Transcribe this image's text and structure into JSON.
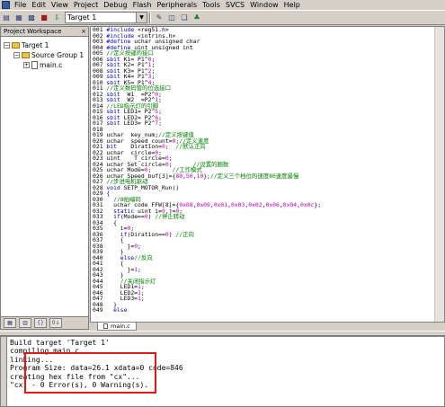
{
  "menu": [
    "File",
    "Edit",
    "View",
    "Project",
    "Debug",
    "Flash",
    "Peripherals",
    "Tools",
    "SVCS",
    "Window",
    "Help"
  ],
  "toolbar": {
    "target": "Target 1"
  },
  "workspace": {
    "title": "Project Workspace",
    "close": "×",
    "tree": [
      {
        "label": "Target 1",
        "level": 0,
        "toggle": "−",
        "kind": "folder"
      },
      {
        "label": "Source Group 1",
        "level": 1,
        "toggle": "−",
        "kind": "folder"
      },
      {
        "label": "main.c",
        "level": 2,
        "toggle": "+",
        "kind": "file"
      }
    ]
  },
  "editor": {
    "tab": "main.c",
    "lines": [
      [
        "001",
        [
          [
            "kw",
            "#include "
          ],
          [
            "t",
            "<reg51.h>"
          ]
        ]
      ],
      [
        "002",
        [
          [
            "kw",
            "#include "
          ],
          [
            "t",
            "<intrins.h>"
          ]
        ]
      ],
      [
        "003",
        [
          [
            "kw",
            "#define "
          ],
          [
            "t",
            "uchar unsigned char"
          ]
        ]
      ],
      [
        "004",
        [
          [
            "kw",
            "#define "
          ],
          [
            "t",
            "uint unsigned int"
          ]
        ]
      ],
      [
        "005",
        [
          [
            "cm",
            "//定义按键的接口"
          ]
        ]
      ],
      [
        "006",
        [
          [
            "kw",
            "sbit "
          ],
          [
            "t",
            "K1= P1^"
          ],
          [
            "num",
            "0"
          ],
          [
            "t",
            ";"
          ]
        ]
      ],
      [
        "007",
        [
          [
            "kw",
            "sbit "
          ],
          [
            "t",
            "K2= P1^"
          ],
          [
            "num",
            "1"
          ],
          [
            "t",
            ";"
          ]
        ]
      ],
      [
        "008",
        [
          [
            "kw",
            "sbit "
          ],
          [
            "t",
            "K3= P1^"
          ],
          [
            "num",
            "2"
          ],
          [
            "t",
            ";"
          ]
        ]
      ],
      [
        "009",
        [
          [
            "kw",
            "sbit "
          ],
          [
            "t",
            "K4= P1^"
          ],
          [
            "num",
            "3"
          ],
          [
            "t",
            ";"
          ]
        ]
      ],
      [
        "010",
        [
          [
            "kw",
            "sbit "
          ],
          [
            "t",
            "K5= P1^"
          ],
          [
            "num",
            "4"
          ],
          [
            "t",
            ";"
          ]
        ]
      ],
      [
        "011",
        [
          [
            "cm",
            "//定义数码管的位选接口"
          ]
        ]
      ],
      [
        "012",
        [
          [
            "kw",
            "sbit "
          ],
          [
            "t",
            " W1  =P2^"
          ],
          [
            "num",
            "0"
          ],
          [
            "t",
            ";"
          ]
        ]
      ],
      [
        "013",
        [
          [
            "kw",
            "sbit "
          ],
          [
            "t",
            " W2  =P2^"
          ],
          [
            "num",
            "1"
          ],
          [
            "t",
            ";"
          ]
        ]
      ],
      [
        "014",
        [
          [
            "cm",
            "//LED指示灯的引脚"
          ]
        ]
      ],
      [
        "015",
        [
          [
            "kw",
            "sbit "
          ],
          [
            "t",
            "LED1= P2^"
          ],
          [
            "num",
            "5"
          ],
          [
            "t",
            ";"
          ]
        ]
      ],
      [
        "016",
        [
          [
            "kw",
            "sbit "
          ],
          [
            "t",
            "LED2= P2^"
          ],
          [
            "num",
            "6"
          ],
          [
            "t",
            ";"
          ]
        ]
      ],
      [
        "017",
        [
          [
            "kw",
            "sbit "
          ],
          [
            "t",
            "LED3= P2^"
          ],
          [
            "num",
            "7"
          ],
          [
            "t",
            ";"
          ]
        ]
      ],
      [
        "018",
        [
          [
            "t",
            ""
          ]
        ]
      ],
      [
        "019",
        [
          [
            "t",
            "uchar  key_num;"
          ],
          [
            "cm",
            "//定义按键值"
          ]
        ]
      ],
      [
        "020",
        [
          [
            "t",
            "uchar  speed_count="
          ],
          [
            "num",
            "0"
          ],
          [
            "t",
            ";"
          ],
          [
            "cm",
            "//定义速度"
          ]
        ]
      ],
      [
        "021",
        [
          [
            "kw",
            "bit"
          ],
          [
            "t",
            "    Diration="
          ],
          [
            "num",
            "0"
          ],
          [
            "t",
            ";  "
          ],
          [
            "cm",
            "//默认正向"
          ]
        ]
      ],
      [
        "022",
        [
          [
            "t",
            "uchar  circle="
          ],
          [
            "num",
            "0"
          ],
          [
            "t",
            ";"
          ]
        ]
      ],
      [
        "023",
        [
          [
            "t",
            "uint    T_circle="
          ],
          [
            "num",
            "0"
          ],
          [
            "t",
            ";"
          ]
        ]
      ],
      [
        "024",
        [
          [
            "t",
            "uchar Set_circle="
          ],
          [
            "num",
            "0"
          ],
          [
            "t",
            ";      "
          ],
          [
            "cm",
            "//设置的圈数"
          ]
        ]
      ],
      [
        "025",
        [
          [
            "t",
            "uchar Mode="
          ],
          [
            "num",
            "0"
          ],
          [
            "t",
            ";      "
          ],
          [
            "cm",
            "//工作模式"
          ]
        ]
      ],
      [
        "026",
        [
          [
            "t",
            "uchar Speed_buf[3]={"
          ],
          [
            "num",
            "80"
          ],
          [
            "t",
            ","
          ],
          [
            "num",
            "50"
          ],
          [
            "t",
            ","
          ],
          [
            "num",
            "10"
          ],
          [
            "t",
            "};"
          ],
          [
            "cm",
            "//定义三个档位的速度80速度最慢"
          ]
        ]
      ],
      [
        "027",
        [
          [
            "cm",
            "//步进电机驱动"
          ]
        ]
      ],
      [
        "028",
        [
          [
            "kw",
            "void "
          ],
          [
            "t",
            "SETP_MOTOR_Run()"
          ]
        ]
      ],
      [
        "029",
        [
          [
            "t",
            "{"
          ]
        ]
      ],
      [
        "030",
        [
          [
            "t",
            "  "
          ],
          [
            "cm",
            "//8拍编码"
          ]
        ]
      ],
      [
        "031",
        [
          [
            "t",
            "  uchar code FFW[8]={"
          ],
          [
            "num",
            "0x08"
          ],
          [
            "t",
            ","
          ],
          [
            "num",
            "0x09"
          ],
          [
            "t",
            ","
          ],
          [
            "num",
            "0x01"
          ],
          [
            "t",
            ","
          ],
          [
            "num",
            "0x03"
          ],
          [
            "t",
            ","
          ],
          [
            "num",
            "0x02"
          ],
          [
            "t",
            ","
          ],
          [
            "num",
            "0x06"
          ],
          [
            "t",
            ","
          ],
          [
            "num",
            "0x04"
          ],
          [
            "t",
            ","
          ],
          [
            "num",
            "0x0c"
          ],
          [
            "t",
            "};"
          ]
        ]
      ],
      [
        "032",
        [
          [
            "t",
            "  "
          ],
          [
            "kw",
            "static "
          ],
          [
            "t",
            "uint i="
          ],
          [
            "num",
            "0"
          ],
          [
            "t",
            ",j="
          ],
          [
            "num",
            "0"
          ],
          [
            "t",
            ";"
          ]
        ]
      ],
      [
        "033",
        [
          [
            "t",
            "  "
          ],
          [
            "kw",
            "if"
          ],
          [
            "t",
            "(Mode=="
          ],
          [
            "num",
            "0"
          ],
          [
            "t",
            ") "
          ],
          [
            "cm",
            "//停止转动"
          ]
        ]
      ],
      [
        "034",
        [
          [
            "t",
            "  {"
          ]
        ]
      ],
      [
        "035",
        [
          [
            "t",
            "    i="
          ],
          [
            "num",
            "0"
          ],
          [
            "t",
            ";"
          ]
        ]
      ],
      [
        "036",
        [
          [
            "t",
            "    "
          ],
          [
            "kw",
            "if"
          ],
          [
            "t",
            "(Diration=="
          ],
          [
            "num",
            "0"
          ],
          [
            "t",
            ") "
          ],
          [
            "cm",
            "//正向"
          ]
        ]
      ],
      [
        "037",
        [
          [
            "t",
            "    {"
          ]
        ]
      ],
      [
        "038",
        [
          [
            "t",
            "      j="
          ],
          [
            "num",
            "0"
          ],
          [
            "t",
            ";"
          ]
        ]
      ],
      [
        "039",
        [
          [
            "t",
            "    }"
          ]
        ]
      ],
      [
        "040",
        [
          [
            "t",
            "    "
          ],
          [
            "kw",
            "else"
          ],
          [
            "cm",
            "//反向"
          ]
        ]
      ],
      [
        "041",
        [
          [
            "t",
            "    {"
          ]
        ]
      ],
      [
        "042",
        [
          [
            "t",
            "      j="
          ],
          [
            "num",
            "1"
          ],
          [
            "t",
            ";"
          ]
        ]
      ],
      [
        "043",
        [
          [
            "t",
            "    }"
          ]
        ]
      ],
      [
        "044",
        [
          [
            "t",
            "    "
          ],
          [
            "cm",
            "//关闭指示灯"
          ]
        ]
      ],
      [
        "045",
        [
          [
            "t",
            "    LED1="
          ],
          [
            "num",
            "1"
          ],
          [
            "t",
            ";"
          ]
        ]
      ],
      [
        "046",
        [
          [
            "t",
            "    LED2="
          ],
          [
            "num",
            "1"
          ],
          [
            "t",
            ";"
          ]
        ]
      ],
      [
        "047",
        [
          [
            "t",
            "    LED3="
          ],
          [
            "num",
            "1"
          ],
          [
            "t",
            ";"
          ]
        ]
      ],
      [
        "048",
        [
          [
            "t",
            "  }"
          ]
        ]
      ],
      [
        "049",
        [
          [
            "t",
            "  "
          ],
          [
            "kw",
            "else"
          ]
        ]
      ]
    ]
  },
  "output": {
    "lines": [
      "Build target 'Target 1'",
      "compiling main.c...",
      "linking...",
      "Program Size: data=26.1 xdata=0 code=846",
      "creating hex file from \"cx\"...",
      "\"cx\" - 0 Error(s), 0 Warning(s)."
    ]
  },
  "colors": {
    "highlight_box": "#e01818",
    "keyword": "#0000c0",
    "comment": "#008000",
    "number": "#c000c0"
  }
}
